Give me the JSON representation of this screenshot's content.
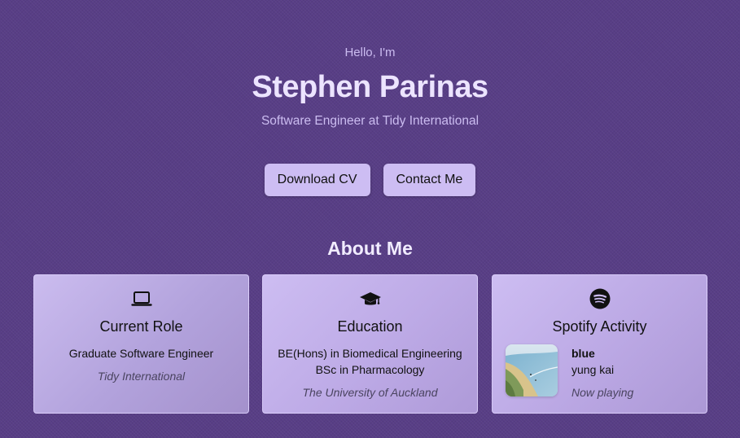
{
  "hero": {
    "greeting": "Hello, I'm",
    "name": "Stephen Parinas",
    "subtitle": "Software Engineer at Tidy International"
  },
  "actions": {
    "download_cv": "Download CV",
    "contact_me": "Contact Me"
  },
  "about": {
    "title": "About Me",
    "cards": {
      "current_role": {
        "icon": "laptop-icon",
        "title": "Current Role",
        "lines": [
          "Graduate Software Engineer"
        ],
        "org": "Tidy International"
      },
      "education": {
        "icon": "graduation-cap-icon",
        "title": "Education",
        "lines": [
          "BE(Hons) in Biomedical Engineering",
          "BSc in Pharmacology"
        ],
        "org": "The University of Auckland"
      },
      "spotify": {
        "icon": "spotify-icon",
        "title": "Spotify Activity",
        "track": "blue",
        "artist": "yung kai",
        "status": "Now playing"
      }
    }
  },
  "colors": {
    "background": "#583e86",
    "button": "#cdbdf3",
    "card": "#c4b2ec"
  }
}
